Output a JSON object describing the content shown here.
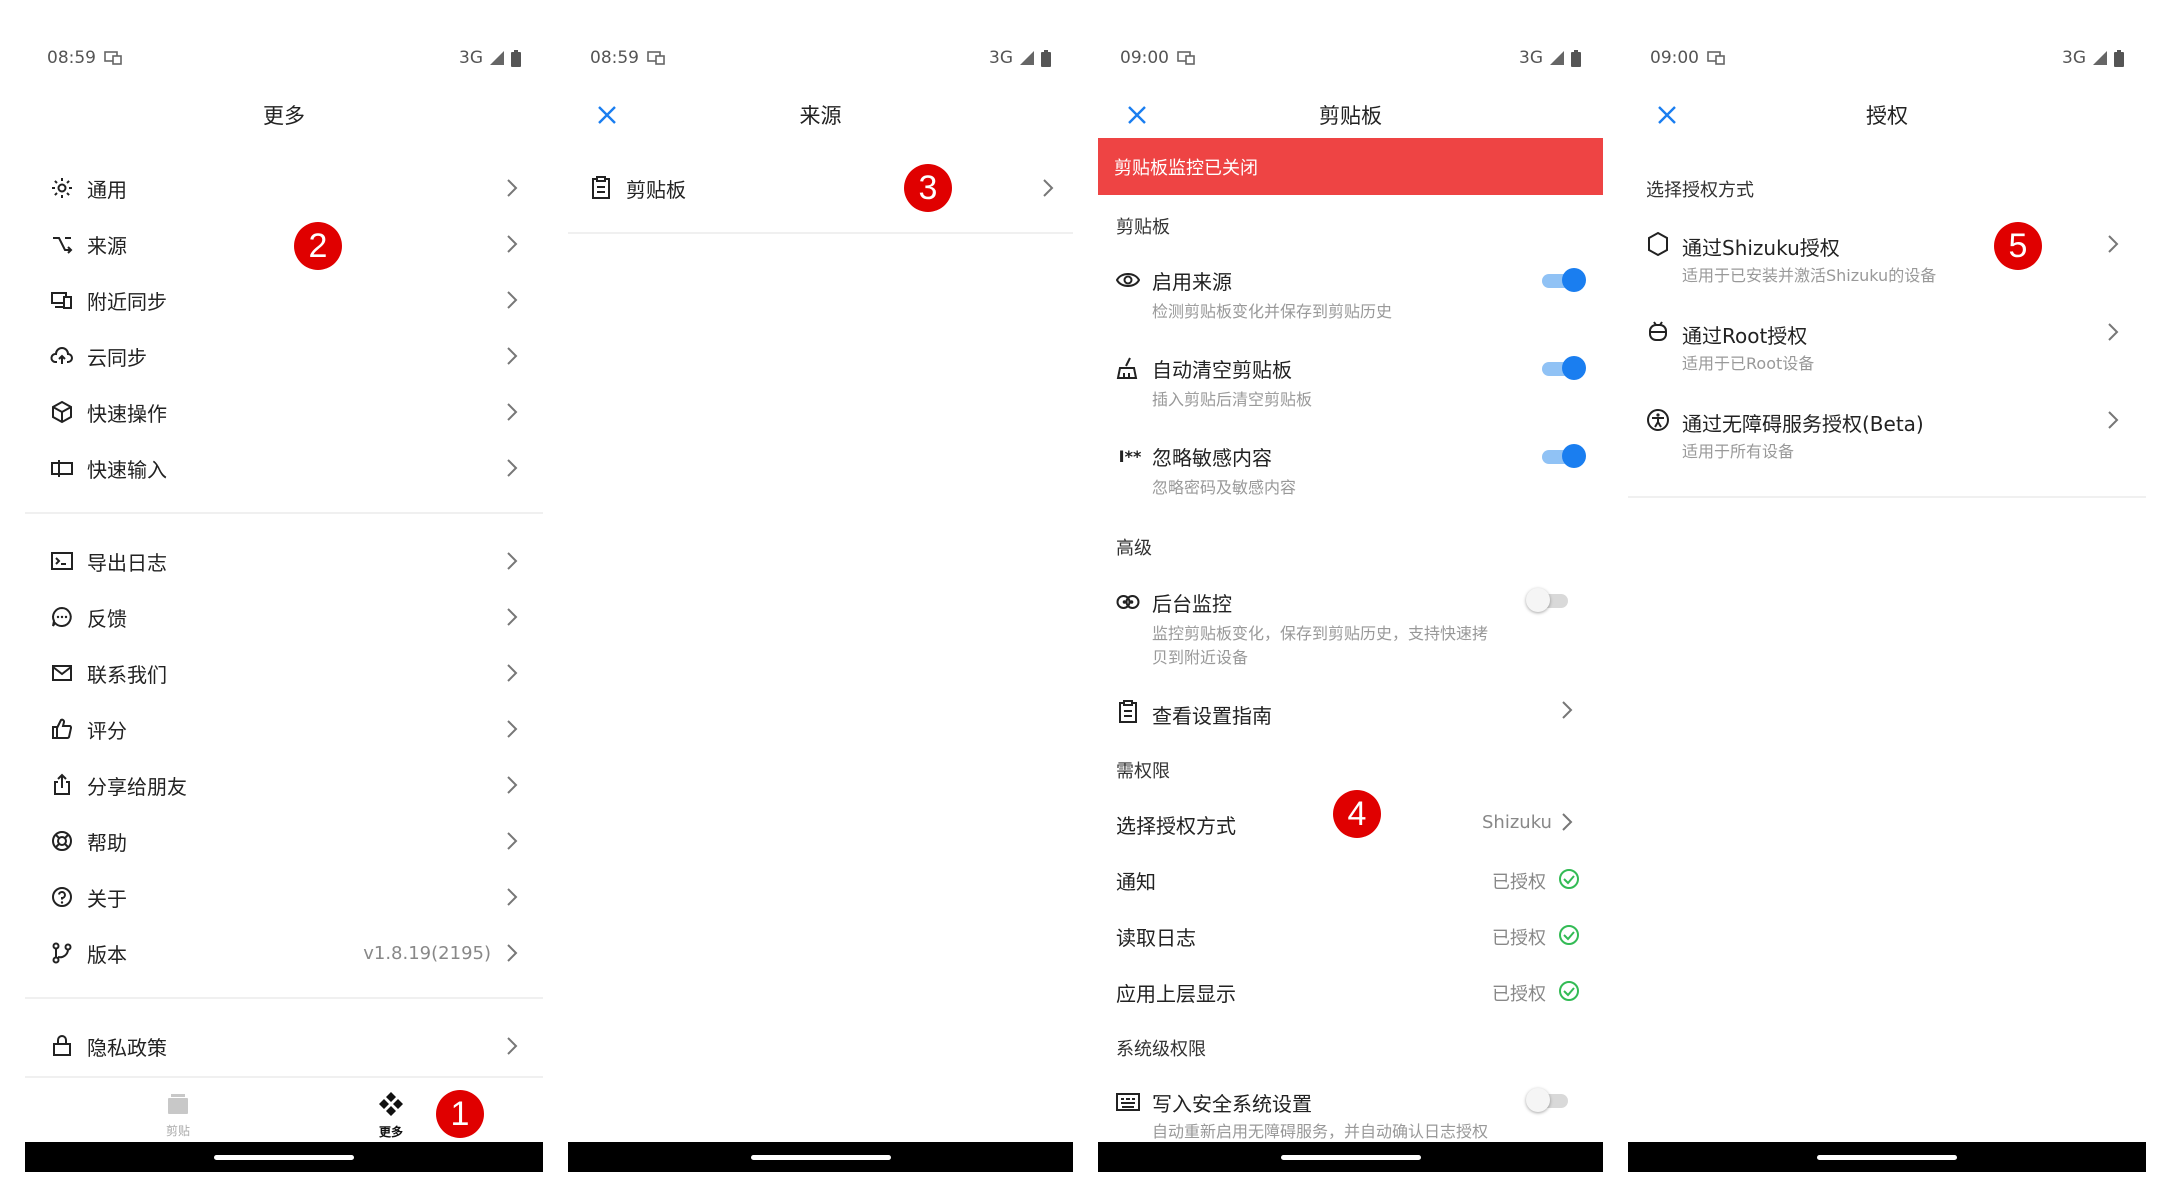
{
  "status": {
    "s1_time": "08:59",
    "s2_time": "08:59",
    "s3_time": "09:00",
    "s4_time": "09:00",
    "network": "3G"
  },
  "screen1": {
    "title": "更多",
    "group1": [
      "通用",
      "来源",
      "附近同步",
      "云同步",
      "快速操作",
      "快速输入"
    ],
    "group2": [
      "导出日志",
      "反馈",
      "联系我们",
      "评分",
      "分享给朋友",
      "帮助",
      "关于",
      "版本"
    ],
    "version_value": "v1.8.19(2195)",
    "privacy": "隐私政策",
    "tabs": {
      "clip": "剪贴",
      "more": "更多"
    }
  },
  "screen2": {
    "title": "来源",
    "item": "剪贴板"
  },
  "screen3": {
    "title": "剪贴板",
    "banner": "剪贴板监控已关闭",
    "sec_clipboard": "剪贴板",
    "enable_source": "启用来源",
    "enable_source_sub": "检测剪贴板变化并保存到剪贴历史",
    "auto_clear": "自动清空剪贴板",
    "auto_clear_sub": "插入剪贴后清空剪贴板",
    "ignore_sensitive": "忽略敏感内容",
    "ignore_sensitive_sub": "忽略密码及敏感内容",
    "sec_advanced": "高级",
    "bg_monitor": "后台监控",
    "bg_monitor_sub1": "监控剪贴板变化，保存到剪贴历史，支持快速拷",
    "bg_monitor_sub2": "贝到附近设备",
    "view_guide": "查看设置指南",
    "sec_perm": "需权限",
    "auth_method": "选择授权方式",
    "auth_method_value": "Shizuku",
    "notify": "通知",
    "read_log": "读取日志",
    "overlay": "应用上层显示",
    "granted": "已授权",
    "sec_system": "系统级权限",
    "write_secure": "写入安全系统设置",
    "write_secure_sub": "自动重新启用无障碍服务，并自动确认日志授权"
  },
  "screen4": {
    "title": "授权",
    "section": "选择授权方式",
    "opt1": "通过Shizuku授权",
    "opt1_sub": "适用于已安装并激活Shizuku的设备",
    "opt2": "通过Root授权",
    "opt2_sub": "适用于已Root设备",
    "opt3": "通过无障碍服务授权(Beta)",
    "opt3_sub": "适用于所有设备"
  },
  "badges": [
    "1",
    "2",
    "3",
    "4",
    "5"
  ],
  "colors": {
    "accent": "#1a7ef0",
    "banner": "#ee4444",
    "badge": "#e00000",
    "granted": "#33bb55"
  }
}
